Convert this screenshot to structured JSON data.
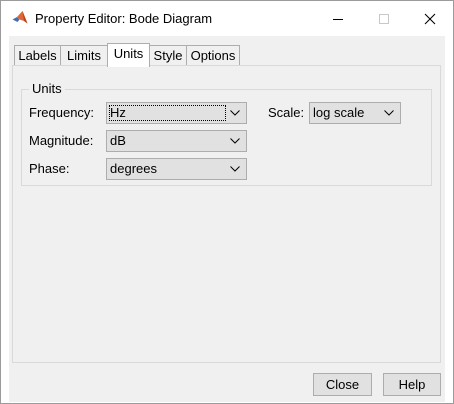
{
  "window": {
    "title": "Property Editor: Bode Diagram"
  },
  "tabs": [
    {
      "label": "Labels"
    },
    {
      "label": "Limits"
    },
    {
      "label": "Units"
    },
    {
      "label": "Style"
    },
    {
      "label": "Options"
    }
  ],
  "active_tab": "Units",
  "units_group": {
    "title": "Units",
    "frequency": {
      "label": "Frequency:",
      "value": "Hz"
    },
    "scale": {
      "label": "Scale:",
      "value": "log scale"
    },
    "magnitude": {
      "label": "Magnitude:",
      "value": "dB"
    },
    "phase": {
      "label": "Phase:",
      "value": "degrees"
    }
  },
  "buttons": {
    "close_label": "Close",
    "help_label": "Help"
  },
  "colors": {
    "dialog_background": "#f0f0f0",
    "control_face": "#e1e1e1",
    "control_border": "#adadad",
    "matlab_icon_orange": "#e16737",
    "matlab_icon_blue": "#3f6fb4"
  }
}
